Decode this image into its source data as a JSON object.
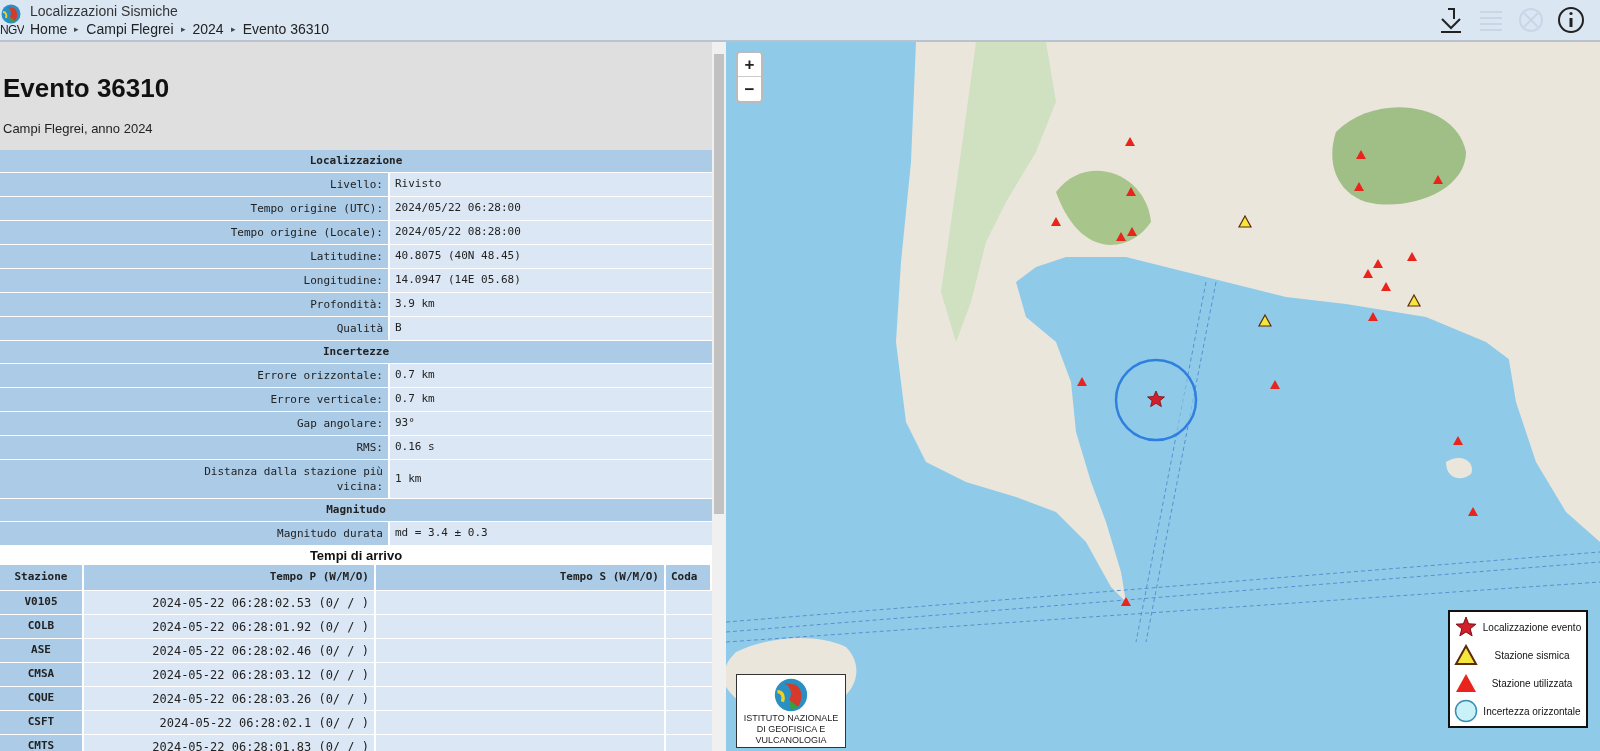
{
  "header": {
    "logo_text": "NGV",
    "title": "Localizzazioni Sismiche",
    "breadcrumb": [
      "Home",
      "Campi Flegrei",
      "2024",
      "Evento 36310"
    ],
    "breadcrumb_separator": "▸",
    "toolbar": [
      {
        "kind": "download",
        "disabled": false
      },
      {
        "kind": "list",
        "disabled": true
      },
      {
        "kind": "cancel",
        "disabled": true
      },
      {
        "kind": "info",
        "disabled": false
      }
    ]
  },
  "event": {
    "title": "Evento 36310",
    "subtitle": "Campi Flegrei, anno 2024"
  },
  "details": [
    {
      "kind": "section",
      "label": "Localizzazione"
    },
    {
      "kind": "field",
      "label": "Livello:",
      "value": "Rivisto"
    },
    {
      "kind": "field",
      "label": "Tempo origine (UTC):",
      "value": "2024/05/22 06:28:00"
    },
    {
      "kind": "field",
      "label": "Tempo origine (Locale):",
      "value": "2024/05/22 08:28:00"
    },
    {
      "kind": "field",
      "label": "Latitudine:",
      "value": "40.8075 (40N 48.45)"
    },
    {
      "kind": "field",
      "label": "Longitudine:",
      "value": "14.0947 (14E 05.68)"
    },
    {
      "kind": "field",
      "label": "Profondità:",
      "value": "3.9 km"
    },
    {
      "kind": "field",
      "label": "Qualità",
      "value": "B"
    },
    {
      "kind": "section",
      "label": "Incertezze"
    },
    {
      "kind": "field",
      "label": "Errore orizzontale:",
      "value": "0.7 km"
    },
    {
      "kind": "field",
      "label": "Errore verticale:",
      "value": "0.7 km"
    },
    {
      "kind": "field",
      "label": "Gap angolare:",
      "value": "93°"
    },
    {
      "kind": "field",
      "label": "RMS:",
      "value": "0.16 s"
    },
    {
      "kind": "field",
      "label": "Distanza dalla stazione più vicina:",
      "value": "1 km"
    },
    {
      "kind": "section",
      "label": "Magnitudo"
    },
    {
      "kind": "field",
      "label": "Magnitudo durata",
      "value": "md = 3.4 ± 0.3"
    }
  ],
  "arrivals": {
    "title": "Tempi di arrivo",
    "columns": [
      "Stazione",
      "Tempo P (W/M/O)",
      "Tempo S (W/M/O)",
      "Coda"
    ],
    "rows": [
      {
        "station": "V0105",
        "p": "2024-05-22 06:28:02.53 (0/ / )"
      },
      {
        "station": "COLB",
        "p": "2024-05-22 06:28:01.92 (0/ / )"
      },
      {
        "station": "ASE",
        "p": "2024-05-22 06:28:02.46 (0/ / )"
      },
      {
        "station": "CMSA",
        "p": "2024-05-22 06:28:03.12 (0/ / )"
      },
      {
        "station": "CQUE",
        "p": "2024-05-22 06:28:03.26 (0/ / )"
      },
      {
        "station": "CSFT",
        "p": "2024-05-22 06:28:02.1 (0/ / )"
      },
      {
        "station": "CMTS",
        "p": "2024-05-22 06:28:01.83 (0/ / )"
      }
    ]
  },
  "map": {
    "zoom": [
      "+",
      "−"
    ],
    "legend": [
      {
        "kind": "event",
        "label": "Localizzazione evento"
      },
      {
        "kind": "seismic",
        "label": "Stazione sismica"
      },
      {
        "kind": "used",
        "label": "Stazione utilizzata"
      },
      {
        "kind": "uncertainty",
        "label": "Incertezza orizzontale"
      }
    ],
    "logo_text": "ISTITUTO NAZIONALE DI GEOFISICA E VULCANOLOGIA"
  }
}
